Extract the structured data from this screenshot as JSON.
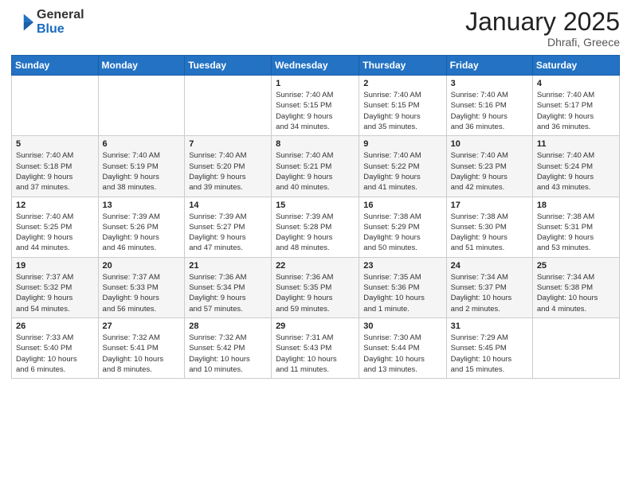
{
  "header": {
    "logo_general": "General",
    "logo_blue": "Blue",
    "month_title": "January 2025",
    "location": "Dhrafi, Greece"
  },
  "days_of_week": [
    "Sunday",
    "Monday",
    "Tuesday",
    "Wednesday",
    "Thursday",
    "Friday",
    "Saturday"
  ],
  "weeks": [
    {
      "cells": [
        {
          "day": "",
          "info": ""
        },
        {
          "day": "",
          "info": ""
        },
        {
          "day": "",
          "info": ""
        },
        {
          "day": "1",
          "info": "Sunrise: 7:40 AM\nSunset: 5:15 PM\nDaylight: 9 hours\nand 34 minutes."
        },
        {
          "day": "2",
          "info": "Sunrise: 7:40 AM\nSunset: 5:15 PM\nDaylight: 9 hours\nand 35 minutes."
        },
        {
          "day": "3",
          "info": "Sunrise: 7:40 AM\nSunset: 5:16 PM\nDaylight: 9 hours\nand 36 minutes."
        },
        {
          "day": "4",
          "info": "Sunrise: 7:40 AM\nSunset: 5:17 PM\nDaylight: 9 hours\nand 36 minutes."
        }
      ]
    },
    {
      "cells": [
        {
          "day": "5",
          "info": "Sunrise: 7:40 AM\nSunset: 5:18 PM\nDaylight: 9 hours\nand 37 minutes."
        },
        {
          "day": "6",
          "info": "Sunrise: 7:40 AM\nSunset: 5:19 PM\nDaylight: 9 hours\nand 38 minutes."
        },
        {
          "day": "7",
          "info": "Sunrise: 7:40 AM\nSunset: 5:20 PM\nDaylight: 9 hours\nand 39 minutes."
        },
        {
          "day": "8",
          "info": "Sunrise: 7:40 AM\nSunset: 5:21 PM\nDaylight: 9 hours\nand 40 minutes."
        },
        {
          "day": "9",
          "info": "Sunrise: 7:40 AM\nSunset: 5:22 PM\nDaylight: 9 hours\nand 41 minutes."
        },
        {
          "day": "10",
          "info": "Sunrise: 7:40 AM\nSunset: 5:23 PM\nDaylight: 9 hours\nand 42 minutes."
        },
        {
          "day": "11",
          "info": "Sunrise: 7:40 AM\nSunset: 5:24 PM\nDaylight: 9 hours\nand 43 minutes."
        }
      ]
    },
    {
      "cells": [
        {
          "day": "12",
          "info": "Sunrise: 7:40 AM\nSunset: 5:25 PM\nDaylight: 9 hours\nand 44 minutes."
        },
        {
          "day": "13",
          "info": "Sunrise: 7:39 AM\nSunset: 5:26 PM\nDaylight: 9 hours\nand 46 minutes."
        },
        {
          "day": "14",
          "info": "Sunrise: 7:39 AM\nSunset: 5:27 PM\nDaylight: 9 hours\nand 47 minutes."
        },
        {
          "day": "15",
          "info": "Sunrise: 7:39 AM\nSunset: 5:28 PM\nDaylight: 9 hours\nand 48 minutes."
        },
        {
          "day": "16",
          "info": "Sunrise: 7:38 AM\nSunset: 5:29 PM\nDaylight: 9 hours\nand 50 minutes."
        },
        {
          "day": "17",
          "info": "Sunrise: 7:38 AM\nSunset: 5:30 PM\nDaylight: 9 hours\nand 51 minutes."
        },
        {
          "day": "18",
          "info": "Sunrise: 7:38 AM\nSunset: 5:31 PM\nDaylight: 9 hours\nand 53 minutes."
        }
      ]
    },
    {
      "cells": [
        {
          "day": "19",
          "info": "Sunrise: 7:37 AM\nSunset: 5:32 PM\nDaylight: 9 hours\nand 54 minutes."
        },
        {
          "day": "20",
          "info": "Sunrise: 7:37 AM\nSunset: 5:33 PM\nDaylight: 9 hours\nand 56 minutes."
        },
        {
          "day": "21",
          "info": "Sunrise: 7:36 AM\nSunset: 5:34 PM\nDaylight: 9 hours\nand 57 minutes."
        },
        {
          "day": "22",
          "info": "Sunrise: 7:36 AM\nSunset: 5:35 PM\nDaylight: 9 hours\nand 59 minutes."
        },
        {
          "day": "23",
          "info": "Sunrise: 7:35 AM\nSunset: 5:36 PM\nDaylight: 10 hours\nand 1 minute."
        },
        {
          "day": "24",
          "info": "Sunrise: 7:34 AM\nSunset: 5:37 PM\nDaylight: 10 hours\nand 2 minutes."
        },
        {
          "day": "25",
          "info": "Sunrise: 7:34 AM\nSunset: 5:38 PM\nDaylight: 10 hours\nand 4 minutes."
        }
      ]
    },
    {
      "cells": [
        {
          "day": "26",
          "info": "Sunrise: 7:33 AM\nSunset: 5:40 PM\nDaylight: 10 hours\nand 6 minutes."
        },
        {
          "day": "27",
          "info": "Sunrise: 7:32 AM\nSunset: 5:41 PM\nDaylight: 10 hours\nand 8 minutes."
        },
        {
          "day": "28",
          "info": "Sunrise: 7:32 AM\nSunset: 5:42 PM\nDaylight: 10 hours\nand 10 minutes."
        },
        {
          "day": "29",
          "info": "Sunrise: 7:31 AM\nSunset: 5:43 PM\nDaylight: 10 hours\nand 11 minutes."
        },
        {
          "day": "30",
          "info": "Sunrise: 7:30 AM\nSunset: 5:44 PM\nDaylight: 10 hours\nand 13 minutes."
        },
        {
          "day": "31",
          "info": "Sunrise: 7:29 AM\nSunset: 5:45 PM\nDaylight: 10 hours\nand 15 minutes."
        },
        {
          "day": "",
          "info": ""
        }
      ]
    }
  ]
}
